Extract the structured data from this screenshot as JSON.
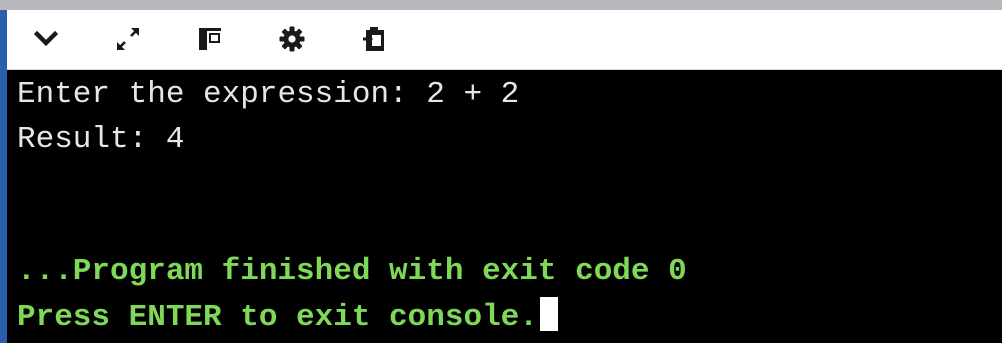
{
  "toolbar": {
    "buttons": [
      {
        "name": "collapse",
        "icon": "chevron-down-icon"
      },
      {
        "name": "expand",
        "icon": "expand-arrows-icon"
      },
      {
        "name": "layout",
        "icon": "panel-layout-icon"
      },
      {
        "name": "settings",
        "icon": "gear-icon"
      },
      {
        "name": "copy",
        "icon": "clipboard-icon"
      }
    ]
  },
  "console": {
    "lines": [
      "Enter the expression: 2 + 2",
      "Result: 4",
      "...Program finished with exit code 0",
      "Press ENTER to exit console."
    ],
    "text_color": "#e6e6e6",
    "status_color": "#7ed957"
  },
  "colors": {
    "toolbar_bg": "#ffffff",
    "console_bg": "#000000",
    "accent_edge": "#2b5fae"
  }
}
